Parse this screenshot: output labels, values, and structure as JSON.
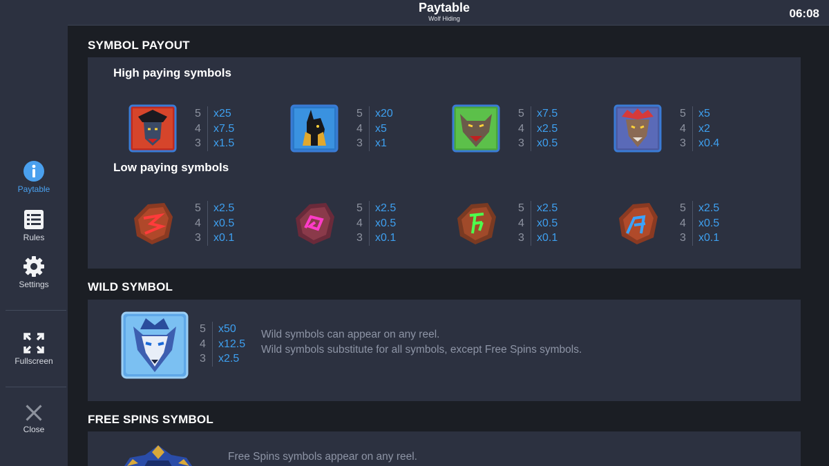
{
  "header": {
    "title": "Paytable",
    "subtitle": "Wolf Hiding",
    "clock": "06:08"
  },
  "sidebar": {
    "items": [
      {
        "label": "Paytable",
        "icon": "info-icon",
        "active": true
      },
      {
        "label": "Rules",
        "icon": "list-icon"
      },
      {
        "label": "Settings",
        "icon": "gear-icon"
      },
      {
        "label": "Fullscreen",
        "icon": "fullscreen-icon"
      },
      {
        "label": "Close",
        "icon": "close-icon"
      }
    ]
  },
  "symbol_payout": {
    "title": "SYMBOL PAYOUT",
    "high_title": "High paying symbols",
    "high": [
      {
        "name": "samurai-wolf-symbol",
        "payouts": [
          {
            "n": "5",
            "v": "x25"
          },
          {
            "n": "4",
            "v": "x7.5"
          },
          {
            "n": "3",
            "v": "x1.5"
          }
        ]
      },
      {
        "name": "anubis-wolf-symbol",
        "payouts": [
          {
            "n": "5",
            "v": "x20"
          },
          {
            "n": "4",
            "v": "x5"
          },
          {
            "n": "3",
            "v": "x1"
          }
        ]
      },
      {
        "name": "green-werewolf-symbol",
        "payouts": [
          {
            "n": "5",
            "v": "x7.5"
          },
          {
            "n": "4",
            "v": "x2.5"
          },
          {
            "n": "3",
            "v": "x0.5"
          }
        ]
      },
      {
        "name": "tribal-wolf-symbol",
        "payouts": [
          {
            "n": "5",
            "v": "x5"
          },
          {
            "n": "4",
            "v": "x2"
          },
          {
            "n": "3",
            "v": "x0.4"
          }
        ]
      }
    ],
    "low_title": "Low paying symbols",
    "low": [
      {
        "name": "red-rune-stone-symbol",
        "glow": "#ff3b3b",
        "payouts": [
          {
            "n": "5",
            "v": "x2.5"
          },
          {
            "n": "4",
            "v": "x0.5"
          },
          {
            "n": "3",
            "v": "x0.1"
          }
        ]
      },
      {
        "name": "pink-rune-stone-symbol",
        "glow": "#ff3bc8",
        "payouts": [
          {
            "n": "5",
            "v": "x2.5"
          },
          {
            "n": "4",
            "v": "x0.5"
          },
          {
            "n": "3",
            "v": "x0.1"
          }
        ]
      },
      {
        "name": "green-rune-stone-symbol",
        "glow": "#4dff4d",
        "payouts": [
          {
            "n": "5",
            "v": "x2.5"
          },
          {
            "n": "4",
            "v": "x0.5"
          },
          {
            "n": "3",
            "v": "x0.1"
          }
        ]
      },
      {
        "name": "blue-rune-stone-symbol",
        "glow": "#3ba3ff",
        "payouts": [
          {
            "n": "5",
            "v": "x2.5"
          },
          {
            "n": "4",
            "v": "x0.5"
          },
          {
            "n": "3",
            "v": "x0.1"
          }
        ]
      }
    ]
  },
  "wild": {
    "title": "WILD SYMBOL",
    "payouts": [
      {
        "n": "5",
        "v": "x50"
      },
      {
        "n": "4",
        "v": "x12.5"
      },
      {
        "n": "3",
        "v": "x2.5"
      }
    ],
    "desc1": "Wild symbols can appear on any reel.",
    "desc2": "Wild symbols substitute for all symbols, except Free Spins symbols."
  },
  "free_spins": {
    "title": "FREE SPINS SYMBOL",
    "desc1": "Free Spins symbols appear on any reel."
  },
  "colors": {
    "accent": "#3ea0f0",
    "panel": "#2c3140",
    "background": "#1b1e24"
  }
}
